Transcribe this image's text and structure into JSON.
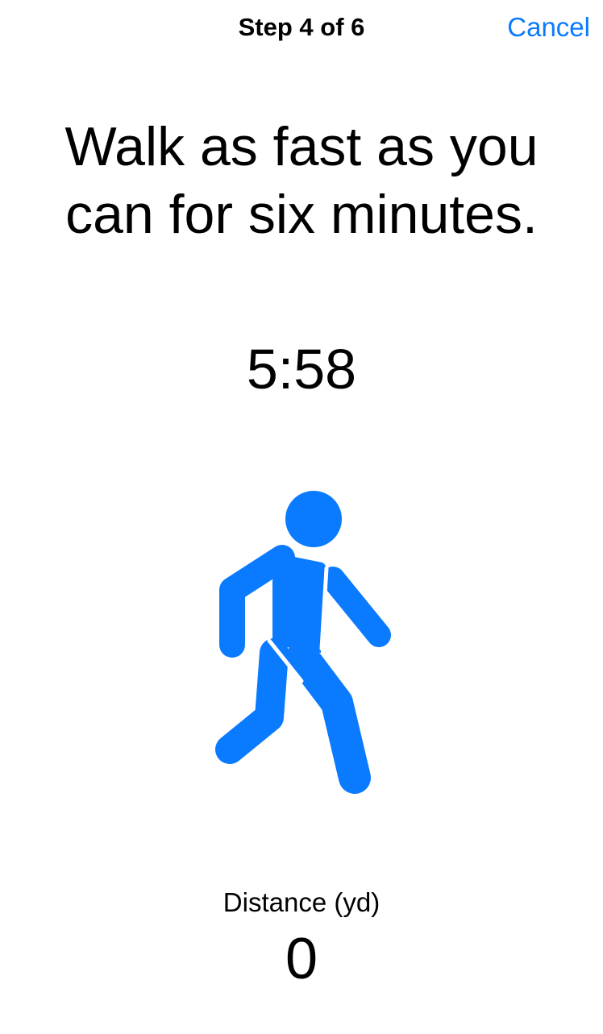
{
  "nav": {
    "title": "Step 4 of 6",
    "cancel_label": "Cancel"
  },
  "instruction": {
    "line1": "Walk as fast as you",
    "line2": "can for six minutes."
  },
  "timer": {
    "value": "5:58"
  },
  "illustration": {
    "icon": "walking-person-icon",
    "color": "#0a7aff"
  },
  "distance": {
    "label": "Distance (yd)",
    "value": "0"
  },
  "colors": {
    "accent": "#0a7aff",
    "background": "#ffffff",
    "text": "#000000"
  }
}
